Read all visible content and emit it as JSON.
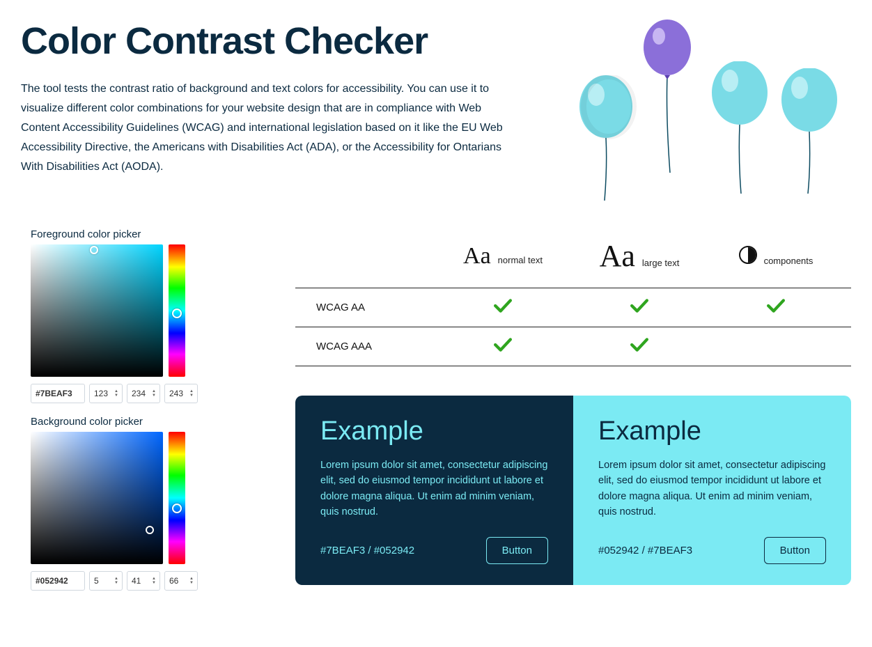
{
  "header": {
    "title": "Color Contrast Checker",
    "intro": "The tool tests the contrast ratio of background and text colors for accessibility. You can use it to visualize different color combinations for your website design that are in compliance with Web Content Accessibility Guidelines (WCAG) and international legislation based on it like the EU Web Accessibility Directive, the Americans with Disabilities Act (ADA), or the Accessibility for Ontarians With Disabilities Act (AODA)."
  },
  "foreground": {
    "label": "Foreground color picker",
    "hex": "#7BEAF3",
    "r": "123",
    "g": "234",
    "b": "243"
  },
  "background": {
    "label": "Background color picker",
    "hex": "#052942",
    "r": "5",
    "g": "41",
    "b": "66"
  },
  "table": {
    "col_normal": "normal text",
    "col_large": "large text",
    "col_components": "components",
    "row_aa": "WCAG AA",
    "row_aaa": "WCAG AAA",
    "aa": {
      "normal": true,
      "large": true,
      "components": true
    },
    "aaa": {
      "normal": true,
      "large": true,
      "components": null
    }
  },
  "example": {
    "heading": "Example",
    "body": "Lorem ipsum dolor sit amet, consectetur adipiscing elit, sed do eiusmod tempor incididunt ut labore et dolore magna aliqua. Ut enim ad minim veniam, quis nostrud.",
    "codes_dark": "#7BEAF3 / #052942",
    "codes_light": "#052942 / #7BEAF3",
    "button": "Button"
  },
  "colors": {
    "fg": "#7BEAF3",
    "bg": "#052942",
    "pass": "#2fa51f"
  }
}
